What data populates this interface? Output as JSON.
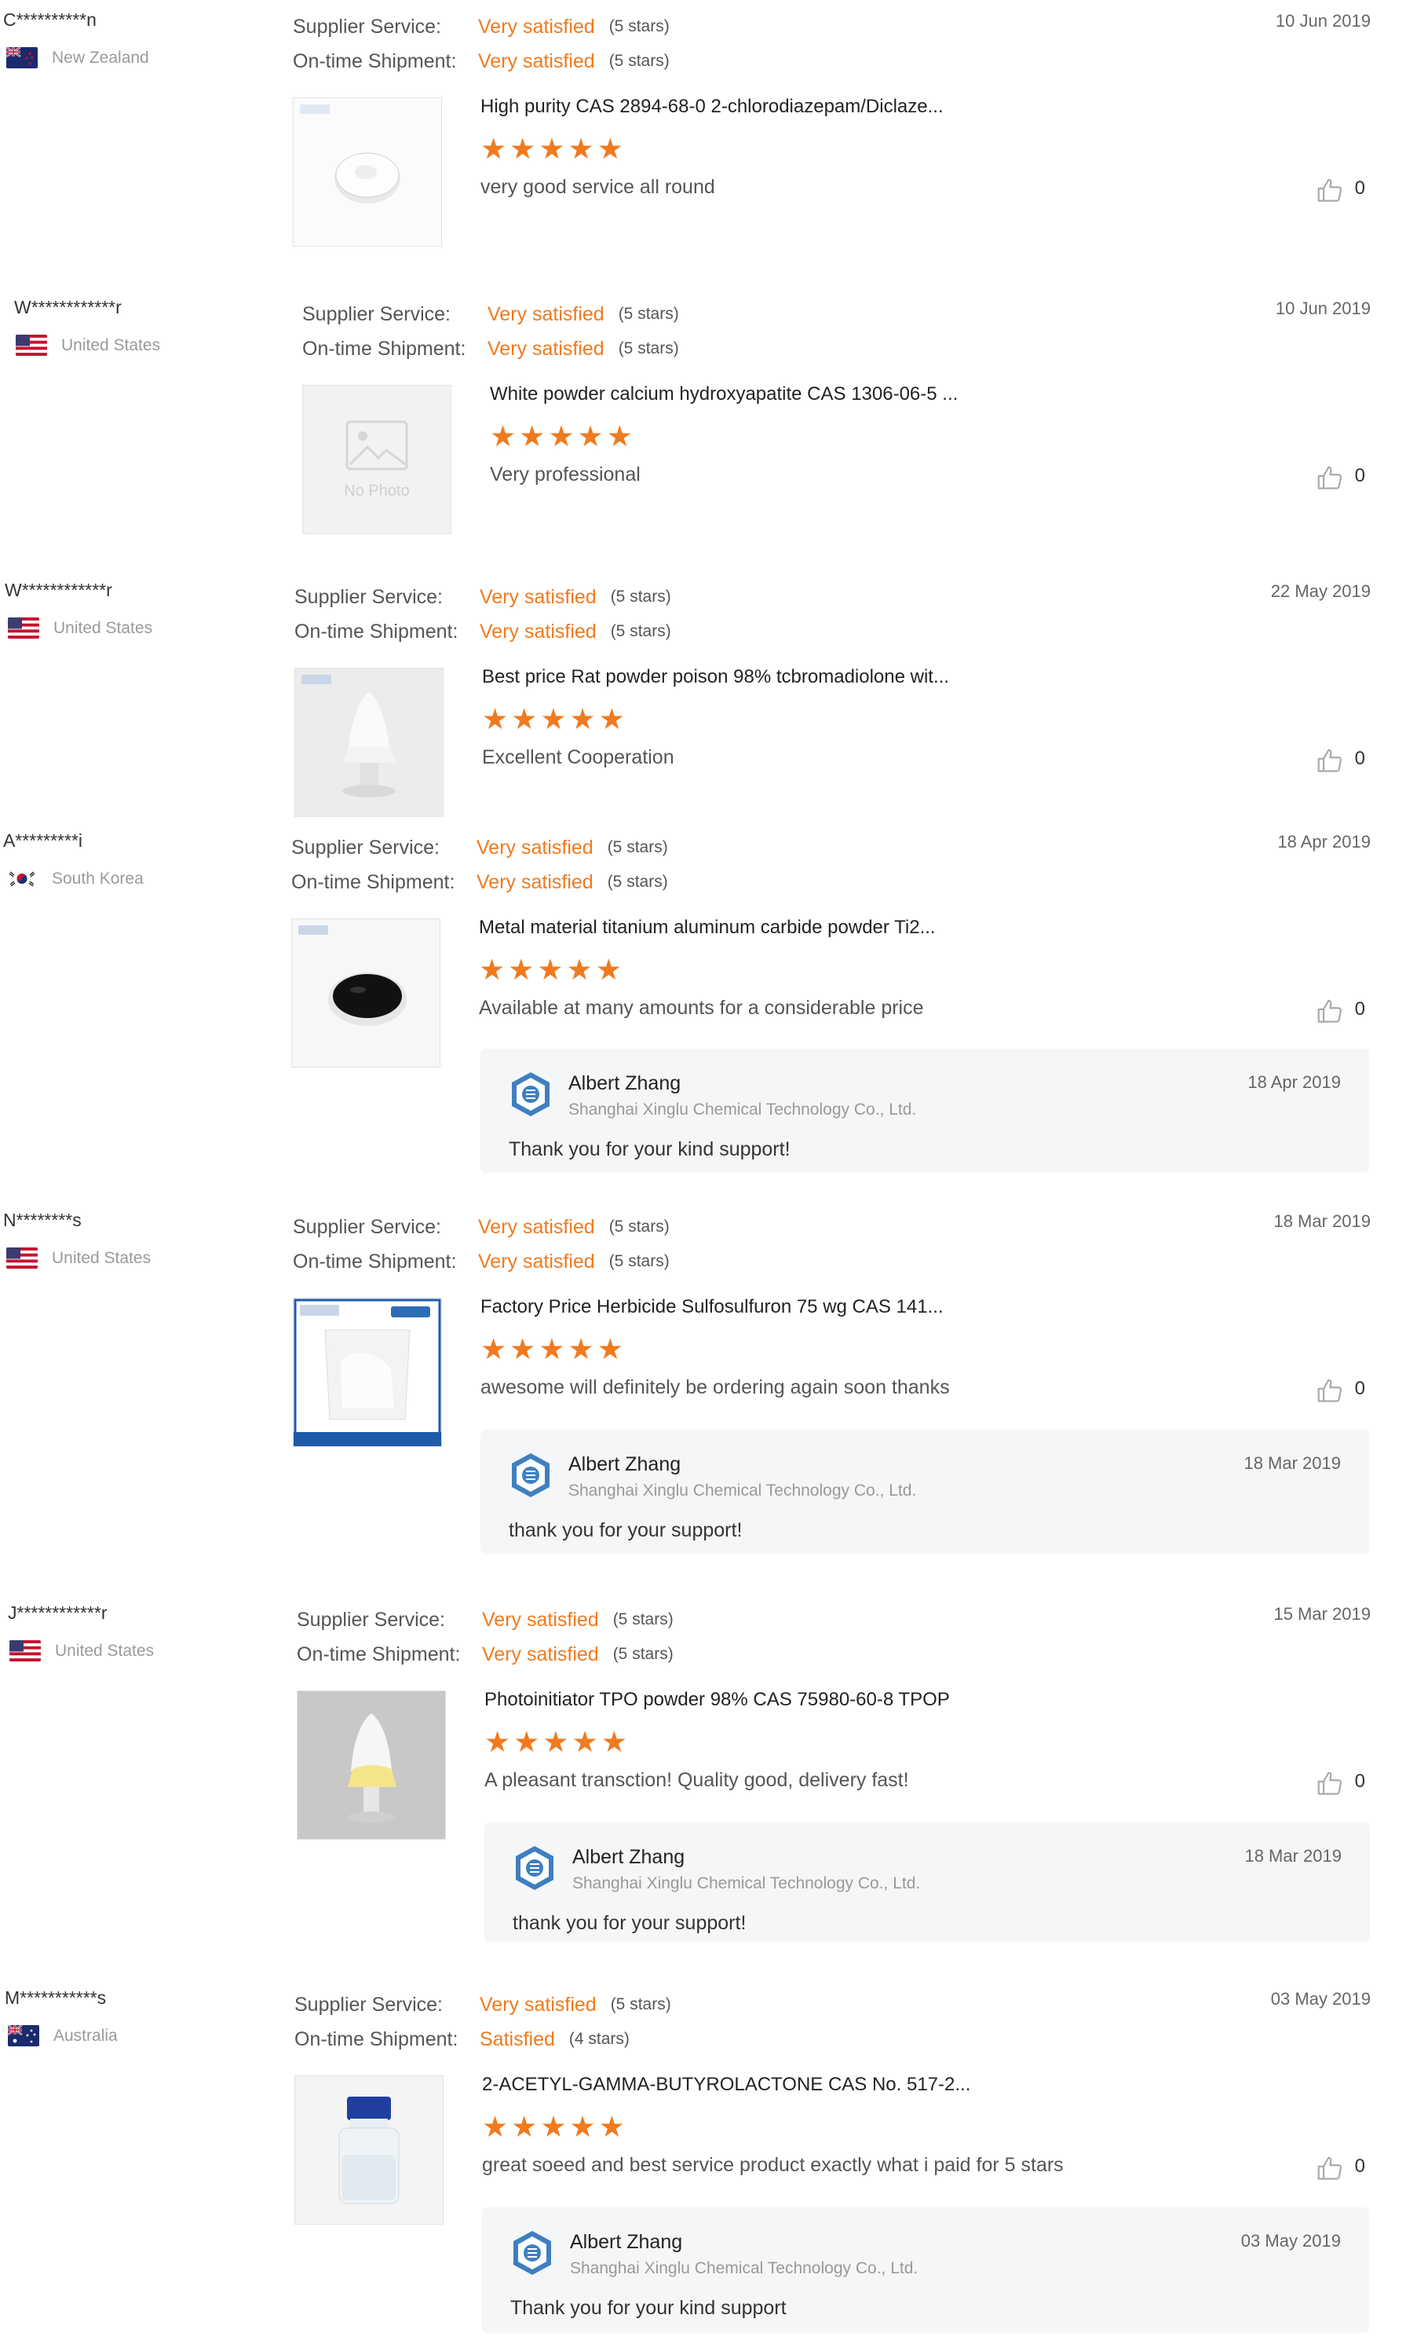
{
  "labels": {
    "supplier_service": "Supplier Service:",
    "ontime_shipment": "On-time Shipment:"
  },
  "colors": {
    "accent": "#f07a1e",
    "reply_bg": "#f5f6f8"
  },
  "reviews": [
    {
      "buyer": "C**********n",
      "country": "New Zealand",
      "flag": "nz-flag",
      "service_rating": "Very satisfied",
      "service_stars": "(5 stars)",
      "shipment_rating": "Very satisfied",
      "shipment_stars": "(5 stars)",
      "date": "10 Jun 2019",
      "product": "High purity CAS 2894-68-0 2-chlorodiazepam/Diclaze...",
      "stars": 5,
      "comment": "very good service all round",
      "likes": "0",
      "thumb_icon": "white-tablet-image",
      "reply": null
    },
    {
      "buyer": "W************r",
      "country": "United States",
      "flag": "us-flag",
      "service_rating": "Very satisfied",
      "service_stars": "(5 stars)",
      "shipment_rating": "Very satisfied",
      "shipment_stars": "(5 stars)",
      "date": "10 Jun 2019",
      "product": "White powder calcium hydroxyapatite CAS 1306-06-5 ...",
      "stars": 5,
      "comment": "Very professional",
      "likes": "0",
      "thumb_icon": "no-photo-placeholder",
      "no_photo_label": "No Photo",
      "reply": null
    },
    {
      "buyer": "W************r",
      "country": "United States",
      "flag": "us-flag",
      "service_rating": "Very satisfied",
      "service_stars": "(5 stars)",
      "shipment_rating": "Very satisfied",
      "shipment_stars": "(5 stars)",
      "date": "22 May 2019",
      "product": "Best price Rat powder poison 98% tcbromadiolone wit...",
      "stars": 5,
      "comment": "Excellent Cooperation",
      "likes": "0",
      "thumb_icon": "white-powder-glass-image",
      "reply": null
    },
    {
      "buyer": "A*********i",
      "country": "South Korea",
      "flag": "kr-flag",
      "service_rating": "Very satisfied",
      "service_stars": "(5 stars)",
      "shipment_rating": "Very satisfied",
      "shipment_stars": "(5 stars)",
      "date": "18 Apr 2019",
      "product": "Metal material titanium aluminum carbide powder Ti2...",
      "stars": 5,
      "comment": "Available at many amounts for a considerable price",
      "likes": "0",
      "thumb_icon": "black-powder-dish-image",
      "reply": {
        "name": "Albert Zhang",
        "company": "Shanghai Xinglu Chemical Technology Co., Ltd.",
        "date": "18 Apr 2019",
        "text": "Thank you for your kind support!"
      }
    },
    {
      "buyer": "N********s",
      "country": "United States",
      "flag": "us-flag",
      "service_rating": "Very satisfied",
      "service_stars": "(5 stars)",
      "shipment_rating": "Very satisfied",
      "shipment_stars": "(5 stars)",
      "date": "18 Mar 2019",
      "product": "Factory Price Herbicide Sulfosulfuron 75 wg CAS 141...",
      "stars": 5,
      "comment": "awesome will definitely be ordering again soon thanks",
      "likes": "0",
      "thumb_icon": "powder-bag-image",
      "reply": {
        "name": "Albert Zhang",
        "company": "Shanghai Xinglu Chemical Technology Co., Ltd.",
        "date": "18 Mar 2019",
        "text": "thank you for your support!"
      }
    },
    {
      "buyer": "J************r",
      "country": "United States",
      "flag": "us-flag",
      "service_rating": "Very satisfied",
      "service_stars": "(5 stars)",
      "shipment_rating": "Very satisfied",
      "shipment_stars": "(5 stars)",
      "date": "15 Mar 2019",
      "product": "Photoinitiator TPO powder 98%  CAS 75980-60-8 TPOP",
      "stars": 5,
      "comment": "A pleasant transction! Quality good, delivery fast!",
      "likes": "0",
      "thumb_icon": "yellow-powder-glass-image",
      "reply": {
        "name": "Albert Zhang",
        "company": "Shanghai Xinglu Chemical Technology Co., Ltd.",
        "date": "18 Mar 2019",
        "text": "thank you for your support!"
      }
    },
    {
      "buyer": "M***********s",
      "country": "Australia",
      "flag": "au-flag",
      "service_rating": "Very satisfied",
      "service_stars": "(5 stars)",
      "shipment_rating": "Satisfied",
      "shipment_stars": "(4 stars)",
      "date": "03 May 2019",
      "product": "2-ACETYL-GAMMA-BUTYROLACTONE CAS No. 517-2...",
      "stars": 5,
      "comment": "great soeed and best service product exactly what i paid for 5 stars",
      "likes": "0",
      "thumb_icon": "blue-cap-bottle-image",
      "reply": {
        "name": "Albert Zhang",
        "company": "Shanghai Xinglu Chemical Technology Co., Ltd.",
        "date": "03 May 2019",
        "text": "Thank you for your kind support"
      }
    }
  ]
}
